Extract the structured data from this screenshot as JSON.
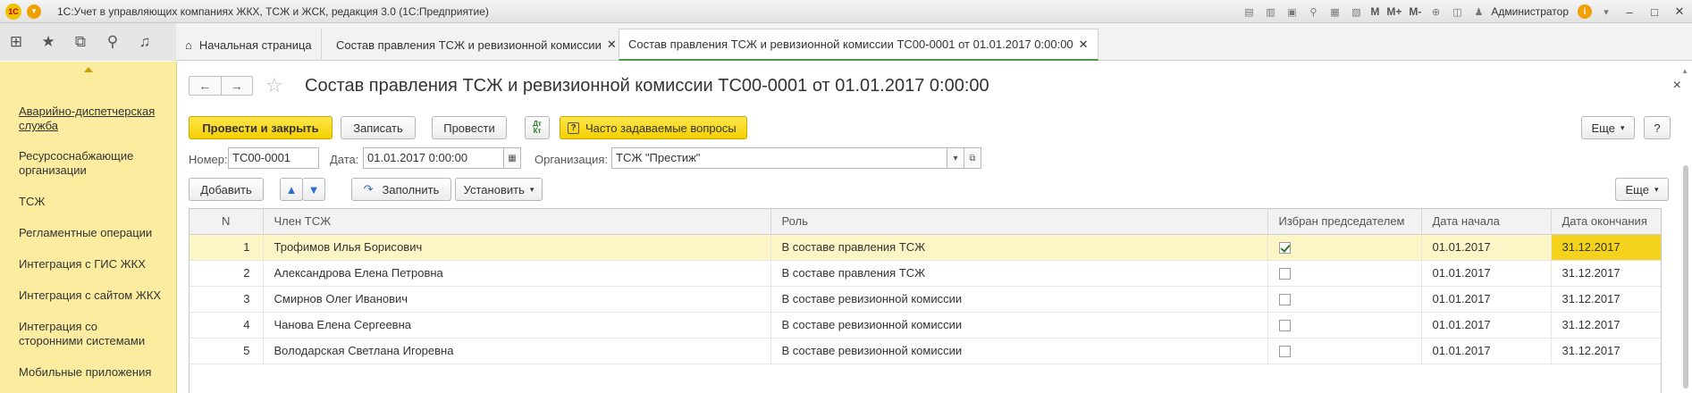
{
  "window": {
    "title": "1С:Учет в управляющих компаниях ЖКХ, ТСЖ и ЖСК, редакция 3.0  (1С:Предприятие)",
    "logo": "1С",
    "menu_glyph": "▾",
    "user": "Администратор",
    "info_glyph": "i",
    "m_buttons": [
      "M",
      "M+",
      "M-"
    ],
    "win_controls": [
      "–",
      "□",
      "✕"
    ]
  },
  "tabs": [
    {
      "label": "Начальная страница",
      "icon": "home-icon"
    },
    {
      "label": "Состав правления ТСЖ и ревизионной комиссии",
      "close": "✕"
    },
    {
      "label": "Состав правления ТСЖ и ревизионной комиссии ТС00-0001 от 01.01.2017 0:00:00",
      "close": "✕"
    }
  ],
  "sidebar": {
    "items": [
      {
        "label": "Аварийно-диспетчерская служба",
        "link": true
      },
      {
        "label": "Ресурсоснабжающие организации"
      },
      {
        "label": "ТСЖ"
      },
      {
        "label": "Регламентные операции"
      },
      {
        "label": "Интеграция с ГИС ЖКХ"
      },
      {
        "label": "Интеграция с сайтом ЖКХ"
      },
      {
        "label": "Интеграция со сторонними системами"
      },
      {
        "label": "Мобильные приложения"
      }
    ]
  },
  "document": {
    "title": "Состав правления ТСЖ и ревизионной комиссии ТС00-0001 от 01.01.2017 0:00:00",
    "close": "×"
  },
  "toolbar": {
    "post_close": "Провести и закрыть",
    "save": "Записать",
    "post": "Провести",
    "dt_kt_top": "Дт",
    "dt_kt_bottom": "Кт",
    "faq": "Часто задаваемые вопросы",
    "faq_icon": "?",
    "more": "Еще",
    "help": "?"
  },
  "fields": {
    "number_label": "Номер:",
    "number_value": "ТС00-0001",
    "date_label": "Дата:",
    "date_value": "01.01.2017  0:00:00",
    "org_label": "Организация:",
    "org_value": "ТСЖ \"Престиж\""
  },
  "table_toolbar": {
    "add": "Добавить",
    "fill": "Заполнить",
    "set": "Установить",
    "more": "Еще"
  },
  "table": {
    "columns": [
      "N",
      "Член ТСЖ",
      "Роль",
      "Избран председателем",
      "Дата начала",
      "Дата окончания"
    ],
    "rows": [
      {
        "n": "1",
        "member": "Трофимов Илья Борисович",
        "role": "В составе правления ТСЖ",
        "chairman": true,
        "start": "01.01.2017",
        "end": "31.12.2017",
        "selected": true
      },
      {
        "n": "2",
        "member": "Александрова Елена Петровна",
        "role": "В составе правления ТСЖ",
        "chairman": false,
        "start": "01.01.2017",
        "end": "31.12.2017"
      },
      {
        "n": "3",
        "member": "Смирнов Олег Иванович",
        "role": "В составе ревизионной комиссии",
        "chairman": false,
        "start": "01.01.2017",
        "end": "31.12.2017"
      },
      {
        "n": "4",
        "member": "Чанова Елена Сергеевна",
        "role": "В составе ревизионной комиссии",
        "chairman": false,
        "start": "01.01.2017",
        "end": "31.12.2017"
      },
      {
        "n": "5",
        "member": "Володарская Светлана Игоревна",
        "role": "В составе ревизионной комиссии",
        "chairman": false,
        "start": "01.01.2017",
        "end": "31.12.2017"
      }
    ]
  }
}
